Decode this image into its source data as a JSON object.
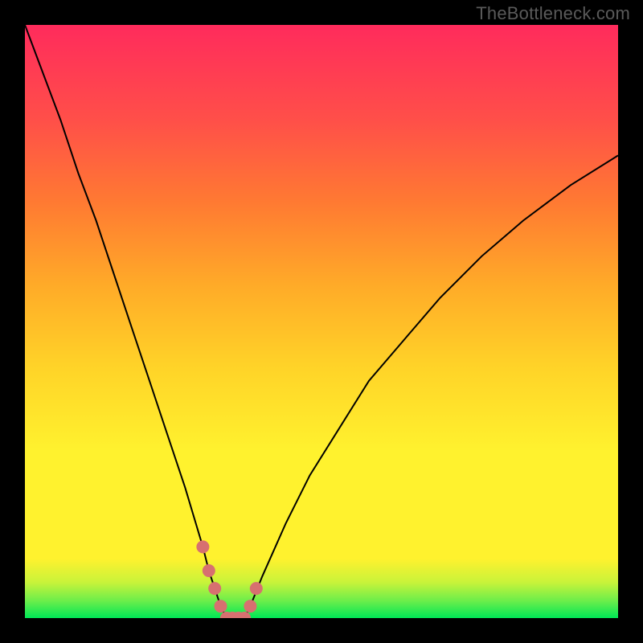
{
  "watermark": "TheBottleneck.com",
  "colors": {
    "frame": "#000000",
    "highlight": "#d77070",
    "gradient_top": "#ff2b5c",
    "gradient_bottom": "#00e756"
  },
  "chart_data": {
    "type": "line",
    "title": "",
    "xlabel": "",
    "ylabel": "",
    "xlim": [
      0,
      100
    ],
    "ylim": [
      0,
      100
    ],
    "grid": false,
    "legend": false,
    "series": [
      {
        "name": "left-branch",
        "x": [
          0,
          3,
          6,
          9,
          12,
          15,
          18,
          21,
          24,
          27,
          30,
          31,
          32,
          33,
          34
        ],
        "y": [
          100,
          92,
          84,
          75,
          67,
          58,
          49,
          40,
          31,
          22,
          12,
          8,
          5,
          2,
          0
        ]
      },
      {
        "name": "right-branch",
        "x": [
          37,
          38,
          40,
          44,
          48,
          53,
          58,
          64,
          70,
          77,
          84,
          92,
          100
        ],
        "y": [
          0,
          2,
          7,
          16,
          24,
          32,
          40,
          47,
          54,
          61,
          67,
          73,
          78
        ]
      }
    ],
    "highlight_points": {
      "comment": "pink/coral dotted segment near the valley",
      "points": [
        {
          "x": 30,
          "y": 12
        },
        {
          "x": 31,
          "y": 8
        },
        {
          "x": 32,
          "y": 5
        },
        {
          "x": 33,
          "y": 2
        },
        {
          "x": 34,
          "y": 0
        },
        {
          "x": 35,
          "y": 0
        },
        {
          "x": 36,
          "y": 0
        },
        {
          "x": 37,
          "y": 0
        },
        {
          "x": 38,
          "y": 2
        },
        {
          "x": 39,
          "y": 5
        }
      ]
    }
  }
}
